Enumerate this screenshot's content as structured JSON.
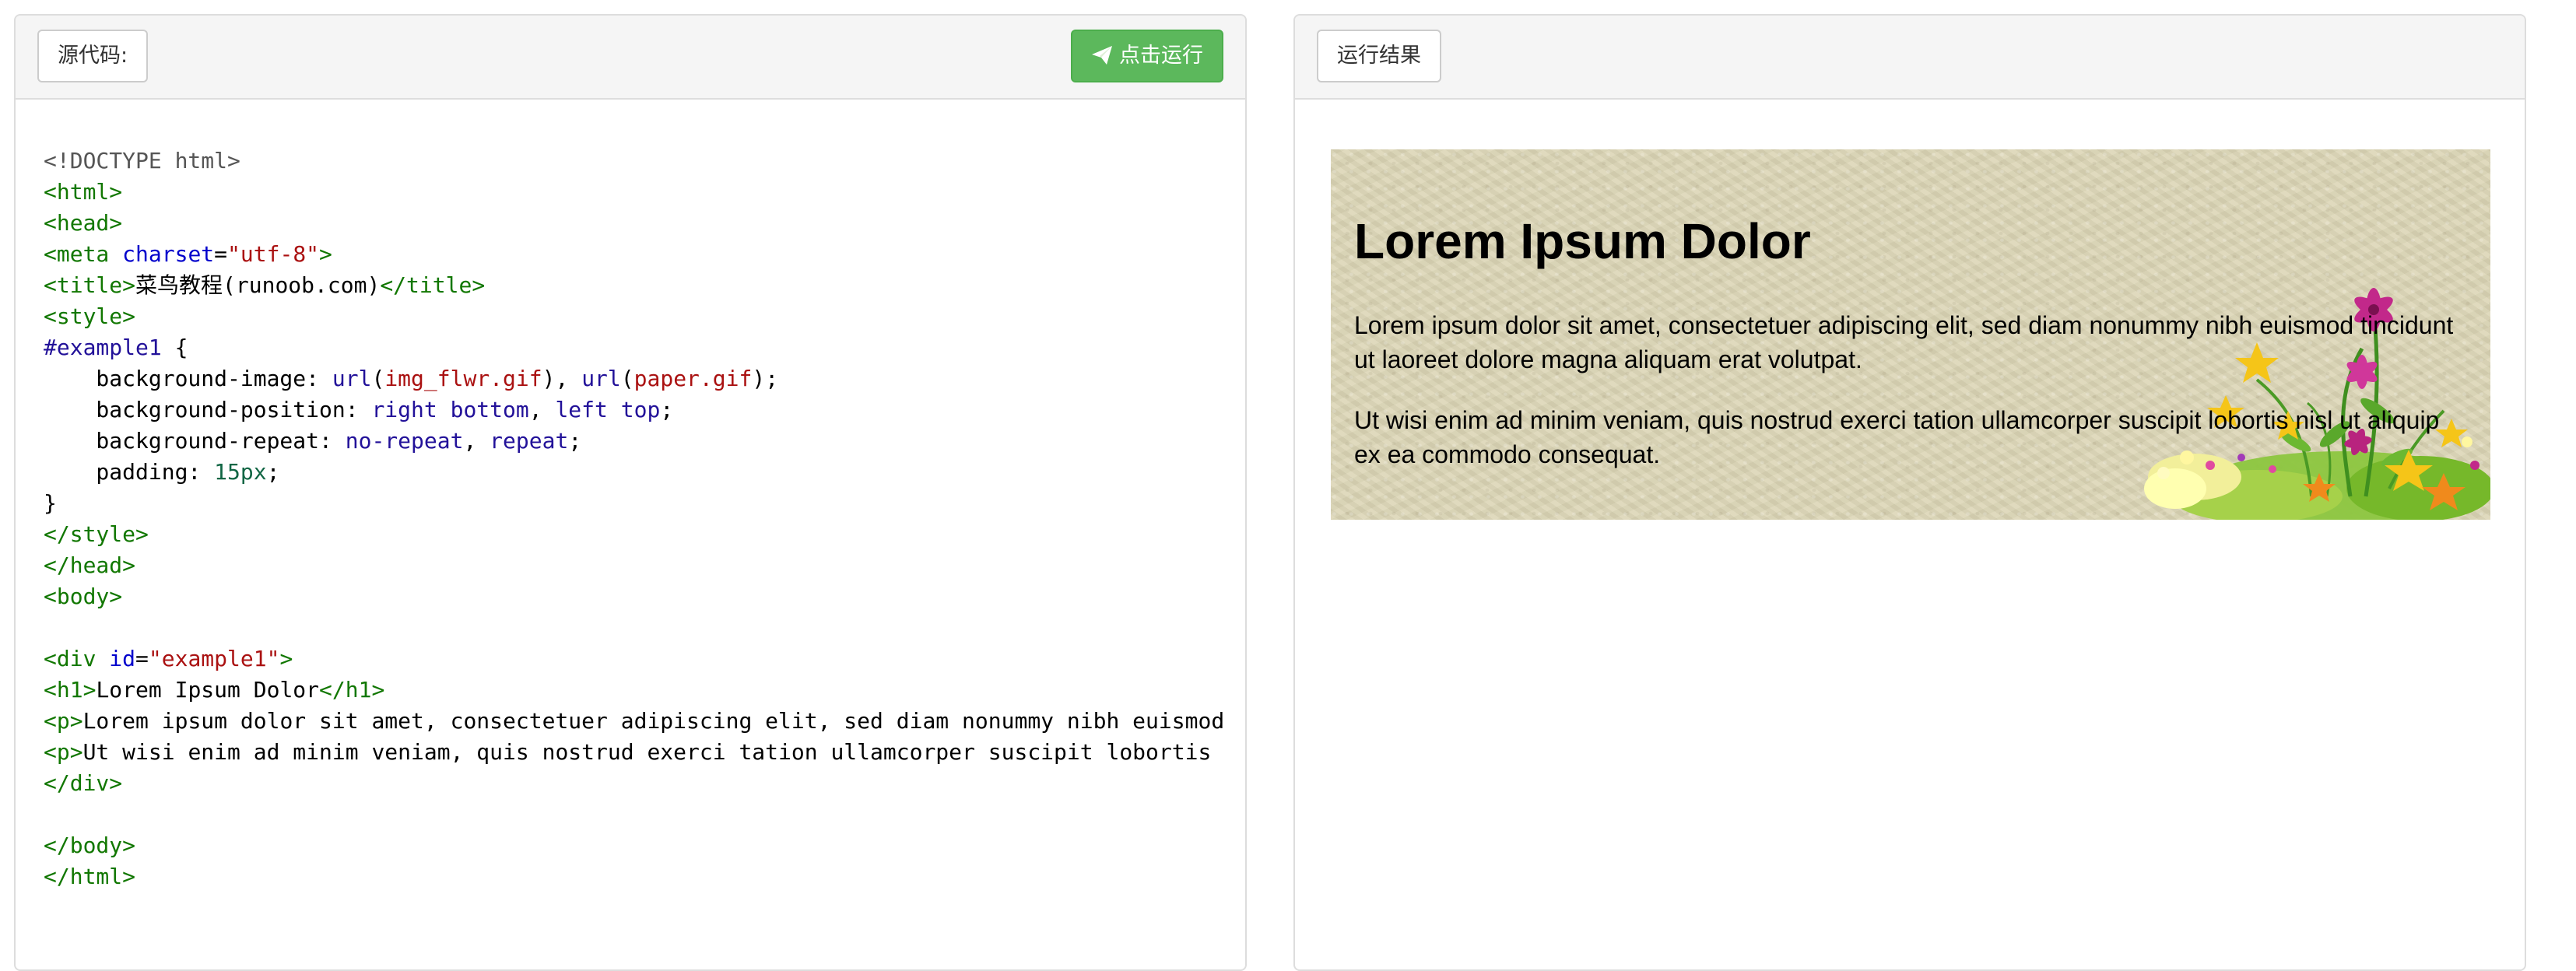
{
  "left_panel": {
    "source_label": "源代码:",
    "run_button_label": "点击运行"
  },
  "right_panel": {
    "result_label": "运行结果"
  },
  "code": {
    "l1": "<!DOCTYPE html>",
    "l2_tag": "<html>",
    "l3_tag": "<head>",
    "l4_open": "<meta ",
    "l4_attr": "charset",
    "l4_eq": "=",
    "l4_val": "\"utf-8\"",
    "l4_close": ">",
    "l5_open": "<title>",
    "l5_text": "菜鸟教程(runoob.com)",
    "l5_close": "</title>",
    "l6_tag": "<style>",
    "l7_sel": "#example1",
    "l7_brace": " {",
    "l8_prop": "    background-image: ",
    "l8_fn1": "url",
    "l8_p1": "(",
    "l8_v1": "img_flwr.gif",
    "l8_p2": "), ",
    "l8_fn2": "url",
    "l8_p3": "(",
    "l8_v2": "paper.gif",
    "l8_p4": ");",
    "l9_prop": "    background-position: ",
    "l9_v1": "right bottom",
    "l9_comma": ", ",
    "l9_v2": "left top",
    "l9_semi": ";",
    "l10_prop": "    background-repeat: ",
    "l10_v1": "no-repeat",
    "l10_comma": ", ",
    "l10_v2": "repeat",
    "l10_semi": ";",
    "l11_prop": "    padding: ",
    "l11_v": "15px",
    "l11_semi": ";",
    "l12": "}",
    "l13_tag": "</style>",
    "l14_tag": "</head>",
    "l15_tag": "<body>",
    "l17_open": "<div ",
    "l17_attr": "id",
    "l17_eq": "=",
    "l17_val": "\"example1\"",
    "l17_close": ">",
    "l18_open": "<h1>",
    "l18_text": "Lorem Ipsum Dolor",
    "l18_close": "</h1>",
    "l19_open": "<p>",
    "l19_text": "Lorem ipsum dolor sit amet, consectetuer adipiscing elit, sed diam nonummy nibh euismod",
    "l20_open": "<p>",
    "l20_text": "Ut wisi enim ad minim veniam, quis nostrud exerci tation ullamcorper suscipit lobortis",
    "l21_tag": "</div>",
    "l23_tag": "</body>",
    "l24_tag": "</html>"
  },
  "result": {
    "heading": "Lorem Ipsum Dolor",
    "paragraph1": "Lorem ipsum dolor sit amet, consectetuer adipiscing elit, sed diam nonummy nibh euismod tincidunt ut laoreet dolore magna aliquam erat volutpat.",
    "paragraph2": "Ut wisi enim ad minim veniam, quis nostrud exerci tation ullamcorper suscipit lobortis nisl ut aliquip ex ea commodo consequat."
  },
  "colors": {
    "run_button": "#5cb85c",
    "tag": "#117700",
    "attribute": "#0000cc",
    "string": "#aa1111",
    "keyword": "#221199",
    "number": "#116644"
  },
  "icons": {
    "run_button_icon": "paper-plane-icon",
    "background_image": "flowers-illustration"
  }
}
